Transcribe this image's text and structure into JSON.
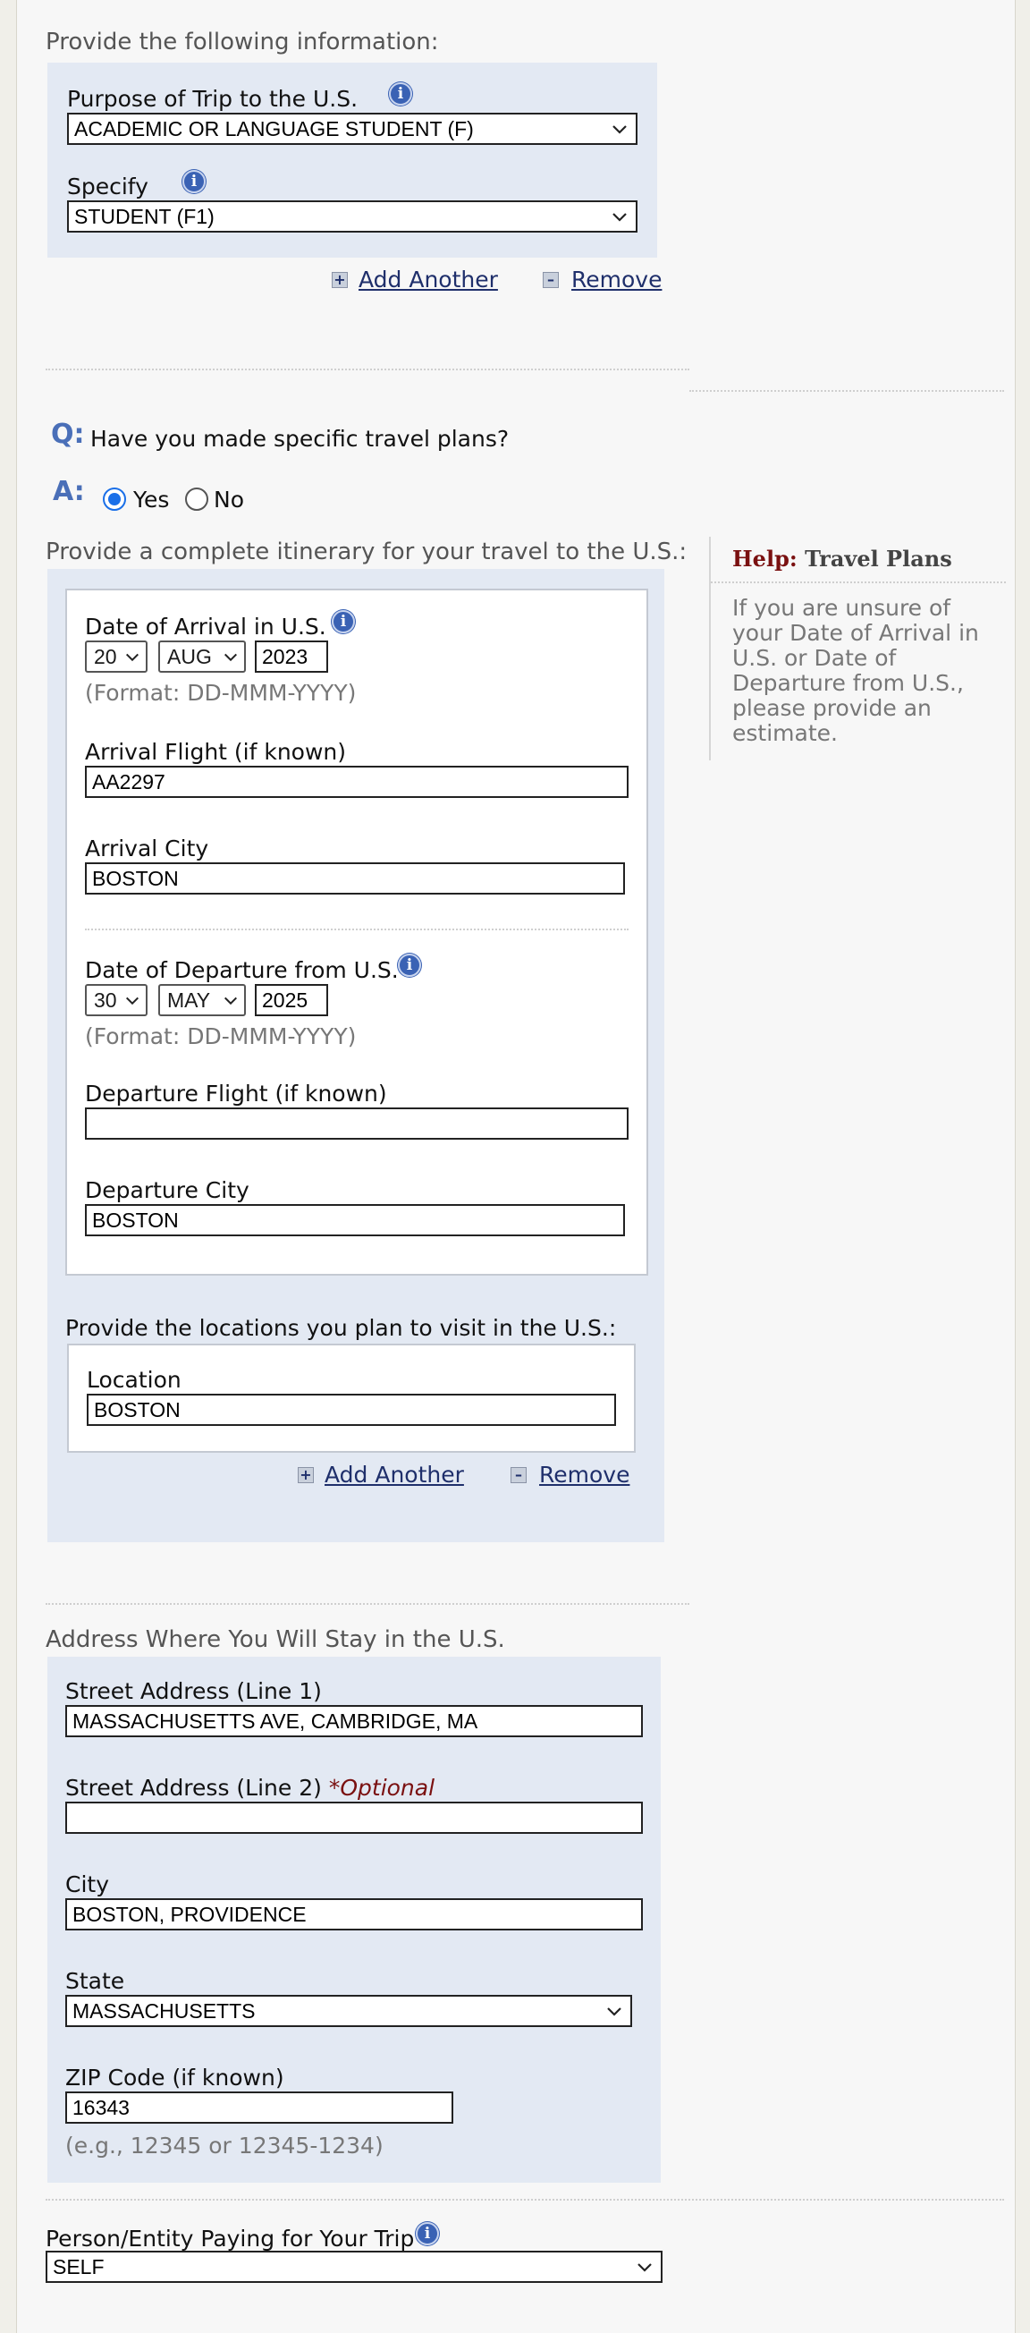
{
  "intro": "Provide the following information:",
  "trip": {
    "purpose_label": "Purpose of Trip to the U.S.",
    "purpose_value": "ACADEMIC OR LANGUAGE STUDENT (F)",
    "specify_label": "Specify",
    "specify_value": "STUDENT (F1)",
    "add_another": "Add Another",
    "remove": "Remove"
  },
  "question": {
    "q_marker": "Q:",
    "text": "Have you made specific travel plans?",
    "a_marker": "A:",
    "yes": "Yes",
    "no": "No",
    "selected": "Yes"
  },
  "itinerary": {
    "prompt": "Provide a complete itinerary for your travel to the U.S.:",
    "arrival_date_label": "Date of Arrival in U.S.",
    "arrival_day": "20",
    "arrival_month": "AUG",
    "arrival_year": "2023",
    "format_hint": "(Format: DD-MMM-YYYY)",
    "arrival_flight_label": "Arrival Flight (if known)",
    "arrival_flight": "AA2297",
    "arrival_city_label": "Arrival City",
    "arrival_city": "BOSTON",
    "departure_date_label": "Date of Departure from U.S.",
    "departure_day": "30",
    "departure_month": "MAY",
    "departure_year": "2025",
    "departure_flight_label": "Departure Flight (if known)",
    "departure_flight": "",
    "departure_city_label": "Departure City",
    "departure_city": "BOSTON",
    "locations_prompt": "Provide the locations you plan to visit in the U.S.:",
    "location_label": "Location",
    "location": "BOSTON",
    "add_another": "Add Another",
    "remove": "Remove"
  },
  "help": {
    "prefix": "Help:",
    "title": "Travel Plans",
    "text": "If you are unsure of your Date of Arrival in U.S. or Date of Departure from U.S., please provide an estimate."
  },
  "address": {
    "heading": "Address Where You Will Stay in the U.S.",
    "line1_label": "Street Address (Line 1)",
    "line1": "MASSACHUSETTS AVE, CAMBRIDGE, MA",
    "line2_label": "Street Address (Line 2)",
    "line2_optional": "*Optional",
    "line2": "",
    "city_label": "City",
    "city": "BOSTON, PROVIDENCE",
    "state_label": "State",
    "state": "MASSACHUSETTS",
    "zip_label": "ZIP Code (if known)",
    "zip": "16343",
    "zip_hint": "(e.g., 12345 or 12345-1234)"
  },
  "payer": {
    "label": "Person/Entity Paying for Your Trip",
    "value": "SELF"
  },
  "colors": {
    "panel": "#e3e9f3",
    "link": "#1f2f6b",
    "accent": "#4a6fb8",
    "help_red": "#7a1010",
    "radio_blue": "#1a6fe8"
  }
}
